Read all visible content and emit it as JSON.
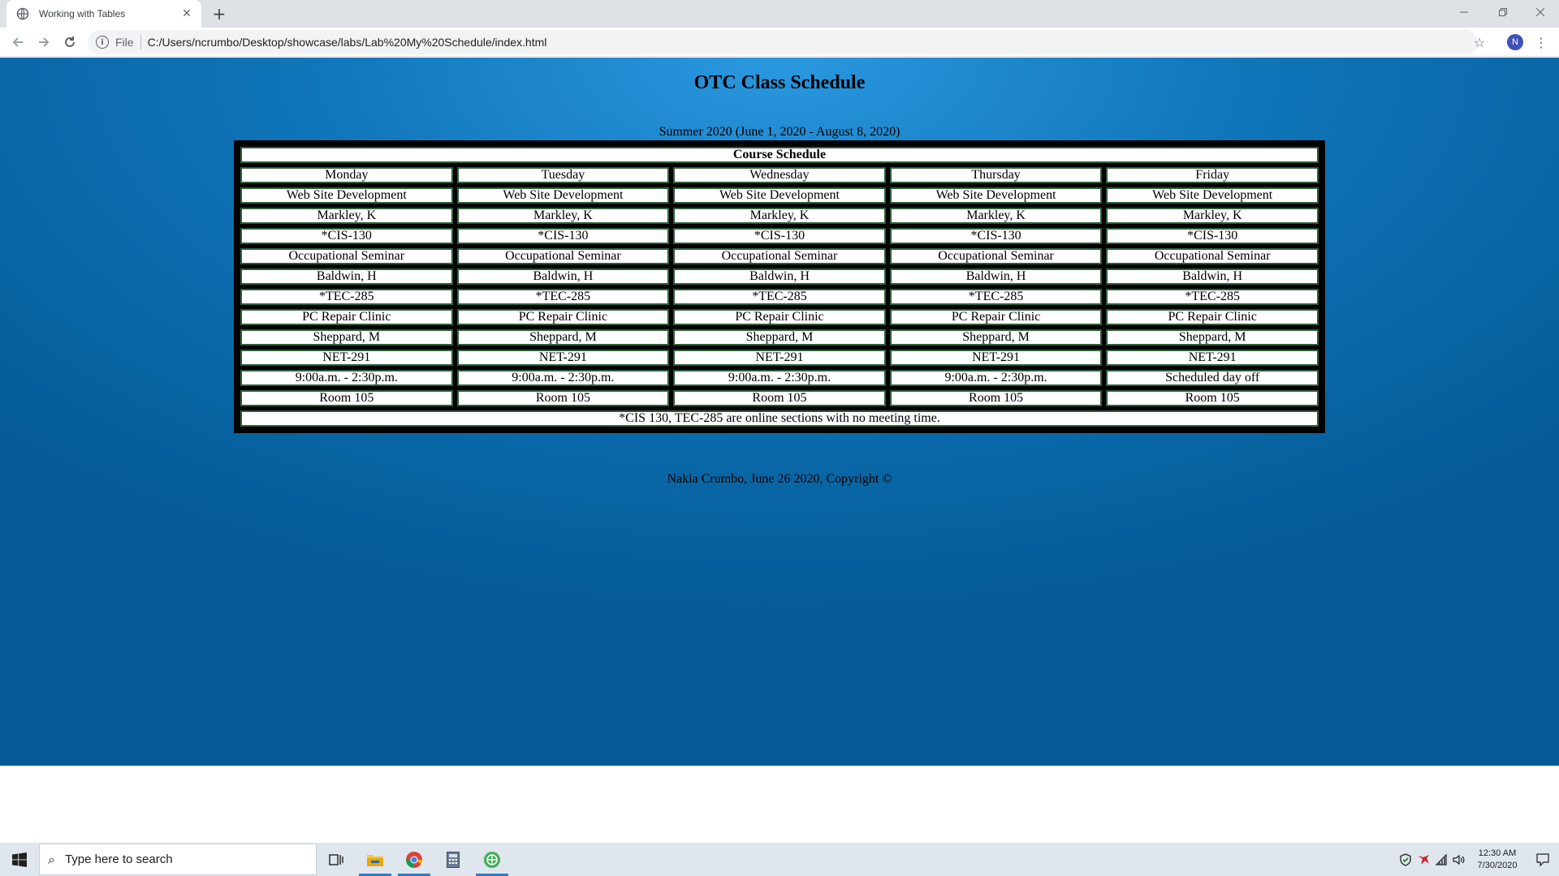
{
  "browser": {
    "tab_title": "Working with Tables",
    "tab_close": "✕",
    "new_tab": "+",
    "scheme": "File",
    "url": "C:/Users/ncrumbo/Desktop/showcase/labs/Lab%20My%20Schedule/index.html",
    "profile_initial": "N"
  },
  "page": {
    "title": "OTC Class Schedule",
    "caption": "Summer 2020 (June 1, 2020 - August 8, 2020)",
    "footer": "Nakia Crumbo, June 26 2020, Copyright ©"
  },
  "schedule": {
    "header": "Course Schedule",
    "days": [
      "Monday",
      "Tuesday",
      "Wednesday",
      "Thursday",
      "Friday"
    ],
    "rows": [
      [
        "Web Site Development",
        "Web Site Development",
        "Web Site Development",
        "Web Site Development",
        "Web Site Development"
      ],
      [
        "Markley, K",
        "Markley, K",
        "Markley, K",
        "Markley, K",
        "Markley, K"
      ],
      [
        "*CIS-130",
        "*CIS-130",
        "*CIS-130",
        "*CIS-130",
        "*CIS-130"
      ],
      [
        "Occupational Seminar",
        "Occupational Seminar",
        "Occupational Seminar",
        "Occupational Seminar",
        "Occupational Seminar"
      ],
      [
        "Baldwin, H",
        "Baldwin, H",
        "Baldwin, H",
        "Baldwin, H",
        "Baldwin, H"
      ],
      [
        "*TEC-285",
        "*TEC-285",
        "*TEC-285",
        "*TEC-285",
        "*TEC-285"
      ],
      [
        "PC Repair Clinic",
        "PC Repair Clinic",
        "PC Repair Clinic",
        "PC Repair Clinic",
        "PC Repair Clinic"
      ],
      [
        "Sheppard, M",
        "Sheppard, M",
        "Sheppard, M",
        "Sheppard, M",
        "Sheppard, M"
      ],
      [
        "NET-291",
        "NET-291",
        "NET-291",
        "NET-291",
        "NET-291"
      ],
      [
        "9:00a.m. - 2:30p.m.",
        "9:00a.m. - 2:30p.m.",
        "9:00a.m. - 2:30p.m.",
        "9:00a.m. - 2:30p.m.",
        "Scheduled day off"
      ],
      [
        "Room 105",
        "Room 105",
        "Room 105",
        "Room 105",
        "Room 105"
      ]
    ],
    "note": "*CIS 130, TEC-285 are online sections with no meeting time."
  },
  "taskbar": {
    "search_placeholder": "Type here to search",
    "time": "12:30 AM",
    "date": "7/30/2020"
  },
  "colors": {
    "page_bg_center": "#2a98e0",
    "page_bg_edge": "#045a95",
    "cell_border": "#2e5e3a"
  }
}
